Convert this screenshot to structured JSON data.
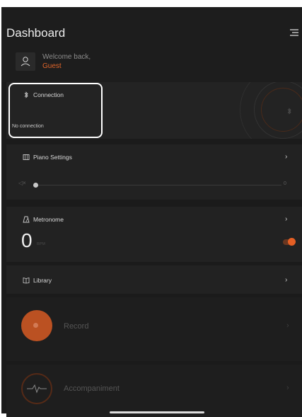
{
  "header": {
    "title": "Dashboard",
    "welcome": "Welcome back,",
    "user": "Guest"
  },
  "connection": {
    "label": "Connection",
    "status": "No connection"
  },
  "piano": {
    "label": "Piano Settings",
    "volume_value": "0",
    "volume_level": 0
  },
  "metronome": {
    "label": "Metronome",
    "bpm": "0",
    "bpm_unit": "BPM",
    "toggle_on": true
  },
  "library": {
    "label": "Library"
  },
  "record": {
    "label": "Record"
  },
  "accompaniment": {
    "label": "Accompaniment"
  },
  "colors": {
    "accent": "#e55f24",
    "background": "#1b1b1b",
    "card": "#222222"
  },
  "icons": [
    "menu-icon",
    "user-icon",
    "bluetooth-icon",
    "piano-icon",
    "volume-icon",
    "metronome-icon",
    "book-icon",
    "record-icon",
    "waveform-icon",
    "chevron-right-icon"
  ]
}
